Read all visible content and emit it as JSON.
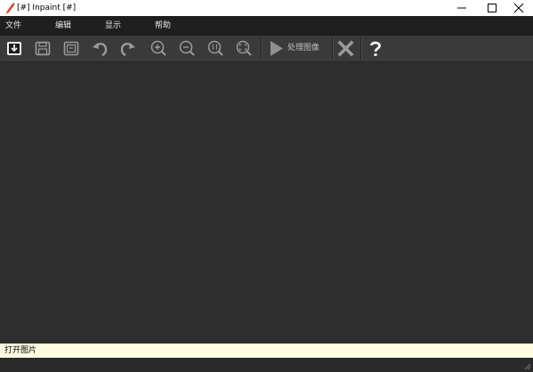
{
  "window": {
    "title": "[#] Inpaint [#]"
  },
  "menu": {
    "items": [
      "文件",
      "编辑",
      "显示",
      "帮助"
    ]
  },
  "toolbar": {
    "buttons": [
      "open-image",
      "save",
      "save-as",
      "undo",
      "redo",
      "zoom-in",
      "zoom-out",
      "zoom-actual-size",
      "zoom-fit"
    ],
    "process_label": "处理图像"
  },
  "status": {
    "text": "打开图片"
  },
  "colors": {
    "menubar": "#1f1f1f",
    "toolbar": "#3a3a3a",
    "canvas": "#2e2e2e",
    "statusbar": "#fdfbe0"
  }
}
